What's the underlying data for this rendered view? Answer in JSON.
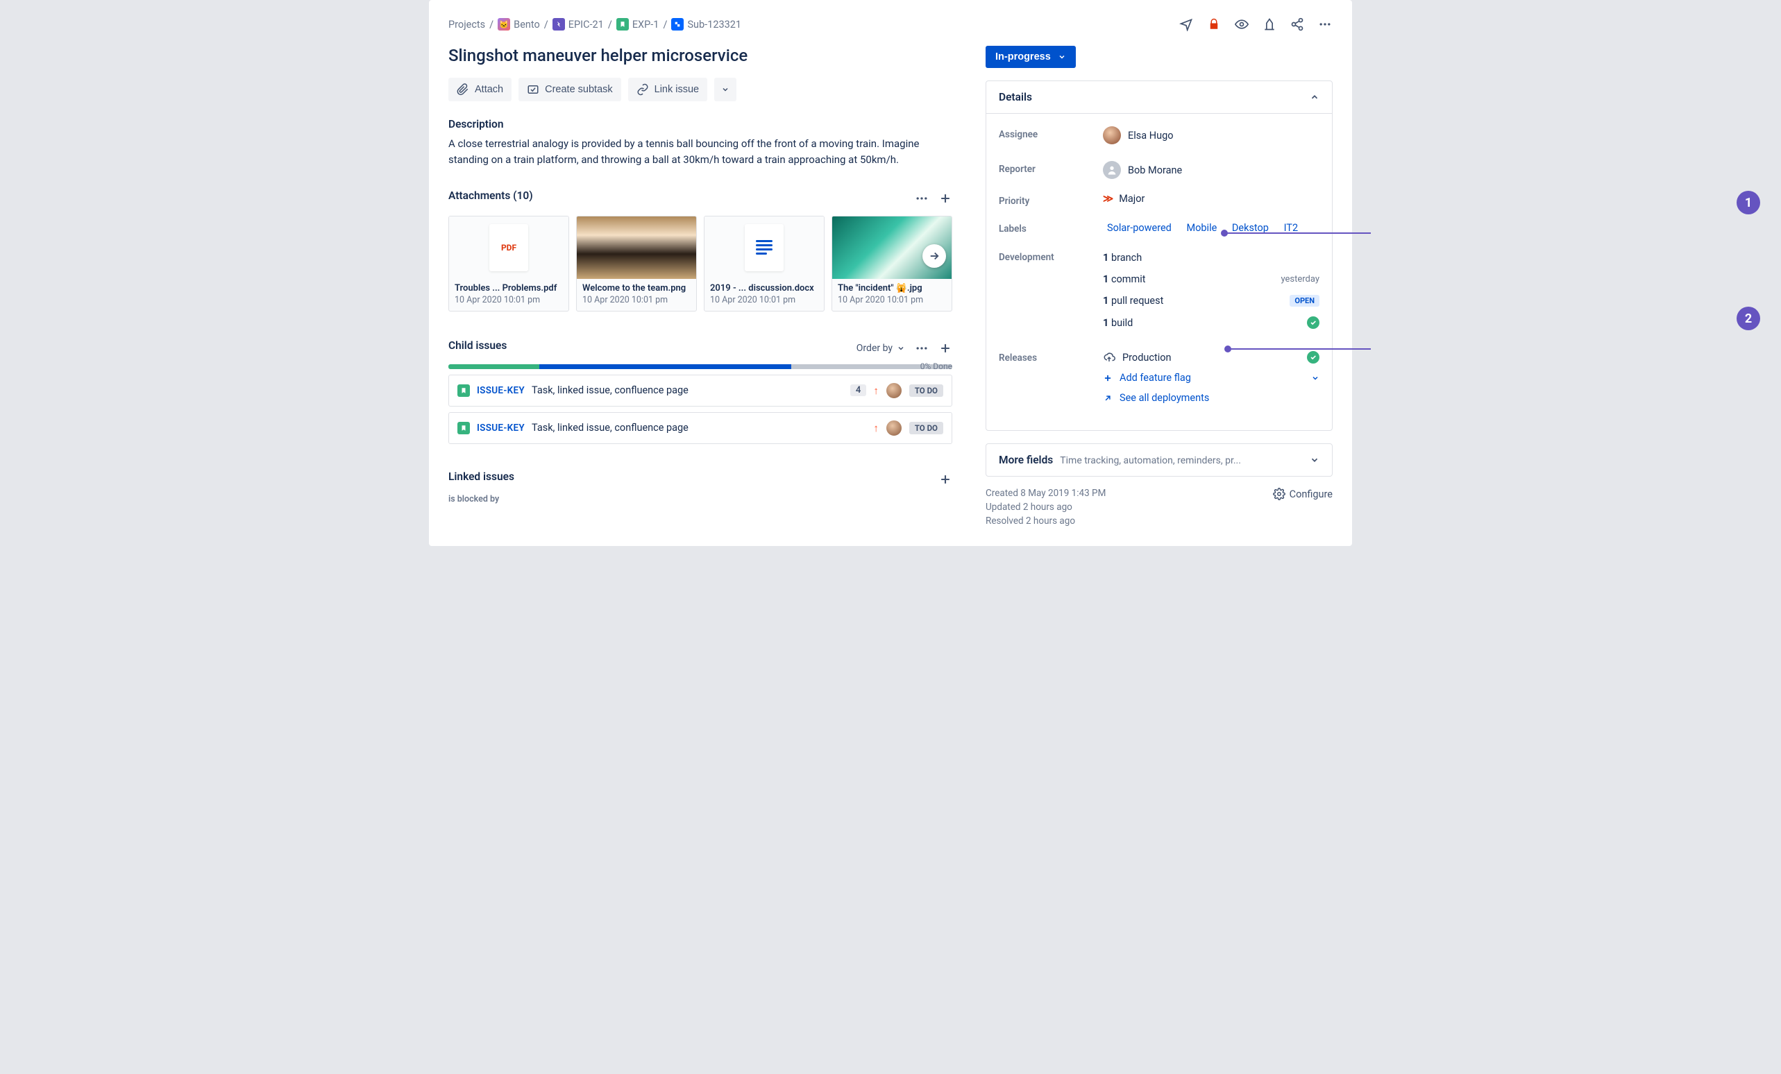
{
  "breadcrumbs": {
    "root": "Projects",
    "project": "Bento",
    "epic": "EPIC-21",
    "exp": "EXP-1",
    "sub": "Sub-123321"
  },
  "title": "Slingshot maneuver helper microservice",
  "actions": {
    "attach": "Attach",
    "subtask": "Create subtask",
    "link": "Link issue"
  },
  "description": {
    "heading": "Description",
    "body": "A close terrestrial analogy is provided by a tennis ball bouncing off the front of a moving train. Imagine standing on a train platform, and throwing a ball at 30km/h toward a train approaching at 50km/h."
  },
  "attachments": {
    "heading": "Attachments (10)",
    "items": [
      {
        "name": "Troubles ... Problems.pdf",
        "date": "10 Apr 2020 10:01 pm",
        "kind": "pdf"
      },
      {
        "name": "Welcome to the team.png",
        "date": "10 Apr 2020 10:01 pm",
        "kind": "img1"
      },
      {
        "name": "2019 - ... discussion.docx",
        "date": "10 Apr 2020 10:01 pm",
        "kind": "doc"
      },
      {
        "name": "The \"incident\" 🙀.jpg",
        "date": "10 Apr 2020 10:01 pm",
        "kind": "img2"
      }
    ]
  },
  "child_issues": {
    "heading": "Child issues",
    "orderby": "Order by",
    "done_pct": "0% Done",
    "rows": [
      {
        "key": "ISSUE-KEY",
        "summary": "Task, linked issue, confluence page",
        "count": "4",
        "status": "TO DO"
      },
      {
        "key": "ISSUE-KEY",
        "summary": "Task, linked issue, confluence page",
        "status": "TO DO"
      }
    ]
  },
  "linked_issues": {
    "heading": "Linked issues",
    "sub": "is blocked by"
  },
  "status": {
    "label": "In-progress"
  },
  "details": {
    "heading": "Details",
    "assignee_label": "Assignee",
    "assignee": "Elsa Hugo",
    "reporter_label": "Reporter",
    "reporter": "Bob Morane",
    "priority_label": "Priority",
    "priority": "Major",
    "labels_label": "Labels",
    "labels": [
      "Solar-powered",
      "Mobile",
      "Dekstop",
      "IT2"
    ],
    "development_label": "Development",
    "development": {
      "branch": {
        "n": "1",
        "t": "branch"
      },
      "commit": {
        "n": "1",
        "t": "commit",
        "meta": "yesterday"
      },
      "pr": {
        "n": "1",
        "t": "pull request",
        "meta": "OPEN"
      },
      "build": {
        "n": "1",
        "t": "build"
      }
    },
    "releases_label": "Releases",
    "releases": {
      "env": "Production",
      "add_flag": "Add feature flag",
      "see_all": "See all deployments"
    }
  },
  "more_fields": {
    "heading": "More fields",
    "sub": "Time tracking, automation, reminders, pr..."
  },
  "footer": {
    "created": "Created 8 May 2019 1:43 PM",
    "updated": "Updated 2 hours ago",
    "resolved": "Resolved 2 hours ago",
    "configure": "Configure"
  },
  "callouts": {
    "one": "1",
    "two": "2"
  }
}
